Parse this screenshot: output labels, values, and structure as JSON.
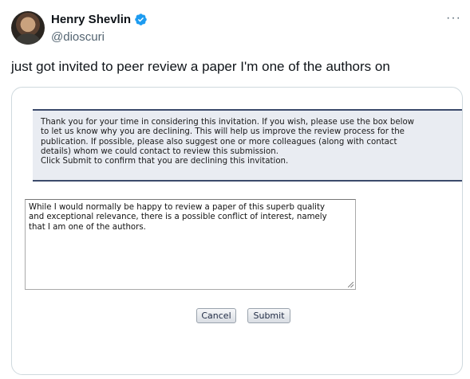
{
  "author": {
    "name": "Henry Shevlin",
    "handle": "@dioscuri",
    "verified": true,
    "avatar_icon": "avatar-photo"
  },
  "tweet": {
    "text": "just got invited to peer review a paper I'm one of the authors on"
  },
  "more_icon": "more-horizontal-icon",
  "screenshot": {
    "notice_lines": [
      "Thank you for your time in considering this invitation. If you wish, please use the box below",
      "to let us know why you are declining. This will help us improve the review process for the",
      "publication. If possible, please also suggest one or more colleagues (along with contact",
      "details) whom we could contact to review this submission.",
      "Click Submit to confirm that you are declining this invitation."
    ],
    "reply_lines": [
      "While I would normally be happy to review a paper of this superb quality",
      "and exceptional relevance, there is a possible conflict of interest, namely",
      "that I am one of the authors."
    ],
    "cancel_label": "Cancel",
    "submit_label": "Submit"
  },
  "colors": {
    "verified_blue": "#1d9bf0",
    "notice_border": "#3b4a6b",
    "notice_bg": "#e9ecf2"
  }
}
